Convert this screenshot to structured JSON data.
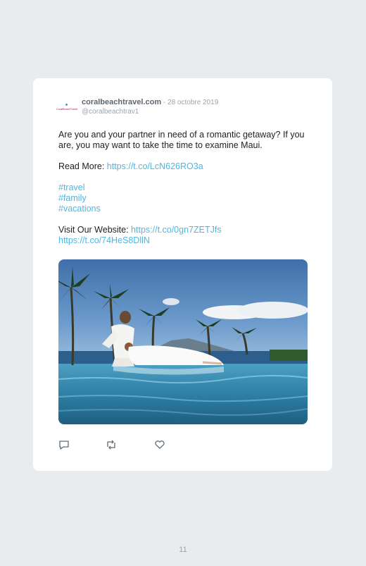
{
  "tweet": {
    "avatar_text": "CoralBeachTravel",
    "display_name": "coralbeachtravel.com",
    "date": " - 28 octobre 2019",
    "handle": "@coralbeachtrav1",
    "text_line1": "Are you and your partner in need of a romantic getaway? If you are, you may want to take the time to examine Maui.",
    "read_more_label": "Read More: ",
    "read_more_link": "https://t.co/LcN626RO3a",
    "hashtags": [
      "#travel",
      "#family",
      "#vacations"
    ],
    "website_label": "Visit Our Website: ",
    "website_link": "https://t.co/0gn7ZETJfs",
    "photo_link": "https://t.co/74HeS8DllN"
  },
  "actions": {
    "reply_icon": "reply-icon",
    "retweet_icon": "retweet-icon",
    "like_icon": "heart-icon"
  },
  "page_number": "11"
}
